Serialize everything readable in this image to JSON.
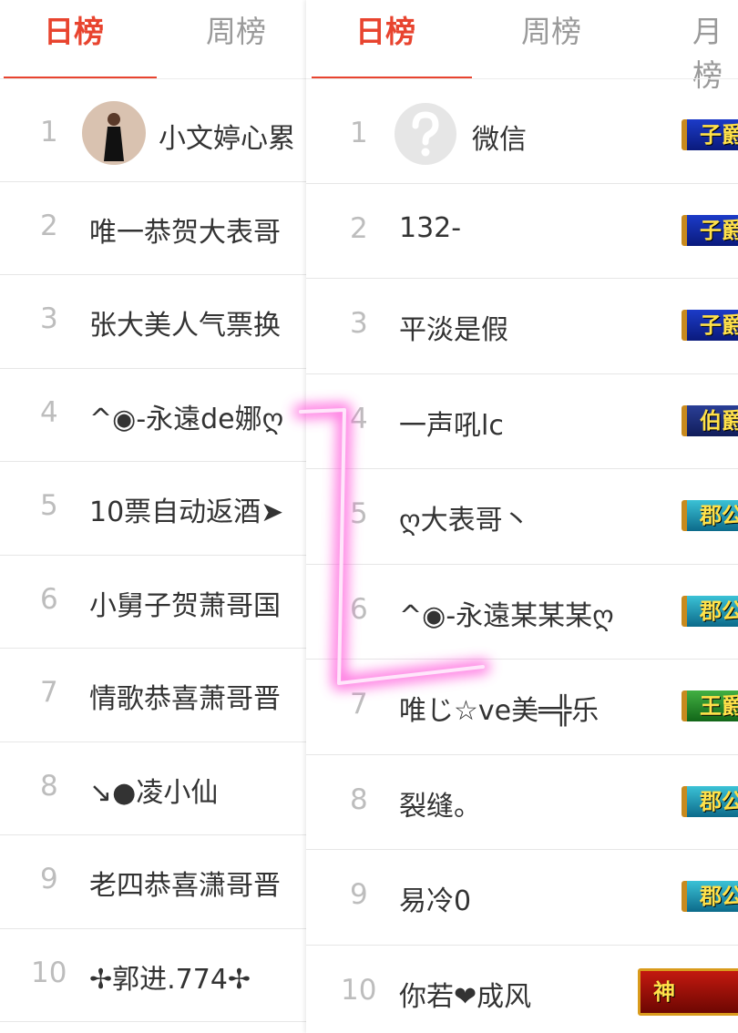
{
  "left": {
    "tabs": [
      {
        "label": "日榜",
        "active": true
      },
      {
        "label": "周榜",
        "active": false
      }
    ],
    "rows": [
      {
        "rank": "1",
        "name": "小文婷心累",
        "avatar": true
      },
      {
        "rank": "2",
        "name": "唯一恭贺大表哥"
      },
      {
        "rank": "3",
        "name": "张大美人气票换"
      },
      {
        "rank": "4",
        "name": "^◉-永遠de娜ღ"
      },
      {
        "rank": "5",
        "name": "10票自动返酒➤"
      },
      {
        "rank": "6",
        "name": "小舅子贺萧哥国"
      },
      {
        "rank": "7",
        "name": "情歌恭喜萧哥晋"
      },
      {
        "rank": "8",
        "name": "↘●凌小仙"
      },
      {
        "rank": "9",
        "name": "老四恭喜潇哥晋"
      },
      {
        "rank": "10",
        "name": "✢郭进.774✢"
      }
    ]
  },
  "right": {
    "tabs": [
      {
        "label": "日榜",
        "active": true
      },
      {
        "label": "周榜",
        "active": false
      },
      {
        "label": "月榜",
        "active": false
      }
    ],
    "rows": [
      {
        "rank": "1",
        "name": "微信",
        "avatar": true,
        "badge": "子爵"
      },
      {
        "rank": "2",
        "name": "132-",
        "badge": "子爵"
      },
      {
        "rank": "3",
        "name": "平淡是假",
        "badge": "子爵"
      },
      {
        "rank": "4",
        "name": "一声吼lc",
        "badge": "伯爵"
      },
      {
        "rank": "5",
        "name": "ღ大表哥丶",
        "badge": "郡公"
      },
      {
        "rank": "6",
        "name": "^◉-永遠某某某ღ",
        "badge": "郡公"
      },
      {
        "rank": "7",
        "name": "唯じ☆ve美═╬乐",
        "badge": "王爵"
      },
      {
        "rank": "8",
        "name": "裂缝。",
        "badge": "郡公"
      },
      {
        "rank": "9",
        "name": "易冷0",
        "badge": "郡公"
      },
      {
        "rank": "10",
        "name": "你若❤成风",
        "badge": "神"
      }
    ]
  },
  "colors": {
    "accent": "#e8442f",
    "glow": "#ff4fd8"
  },
  "icons": {
    "right_row1_avatar": "question-mark-icon"
  }
}
